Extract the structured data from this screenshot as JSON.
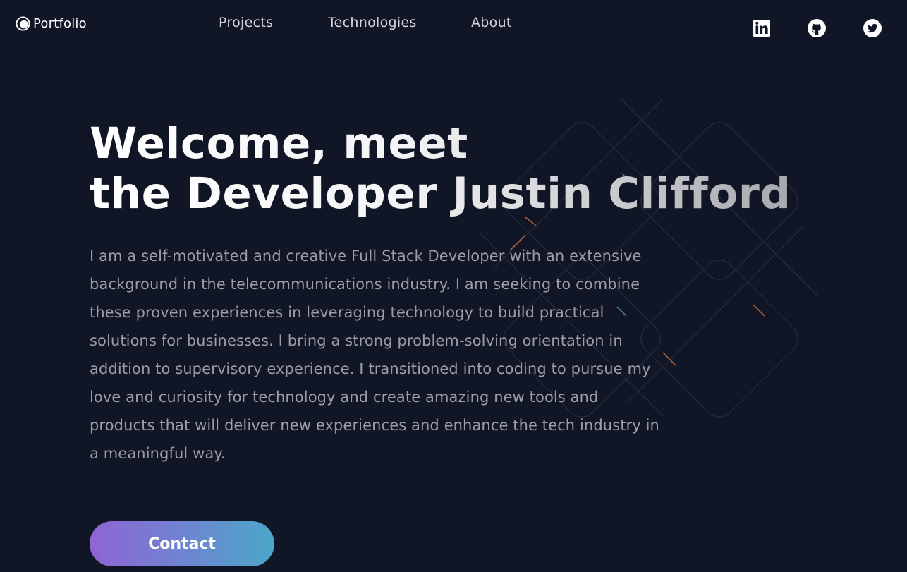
{
  "header": {
    "logo_text": "Portfolio",
    "logo_icon": "crescent-circle-icon",
    "nav": [
      {
        "label": "Projects"
      },
      {
        "label": "Technologies"
      },
      {
        "label": "About"
      }
    ],
    "social": [
      {
        "icon": "linkedin-icon"
      },
      {
        "icon": "github-icon"
      },
      {
        "icon": "twitter-icon"
      }
    ]
  },
  "hero": {
    "title_line1": "Welcome, meet",
    "title_line2": "the Developer Justin Clifford",
    "description": "I am a self-motivated and creative Full Stack Developer with an extensive background in the telecommunications industry. I am seeking to combine these proven experiences in leveraging technology to build practical solutions for businesses. I bring a strong problem-solving orientation in addition to supervisory experience. I transitioned into coding to pursue my love and curiosity for technology and create amazing new tools and products that will deliver new experiences and enhance the tech industry in a meaningful way.",
    "contact_label": "Contact"
  },
  "colors": {
    "background": "#111626",
    "nav_text": "#d2d4da",
    "body_text": "#9c9ca4",
    "button_gradient_start": "#9064d4",
    "button_gradient_end": "#4aa7c8"
  }
}
